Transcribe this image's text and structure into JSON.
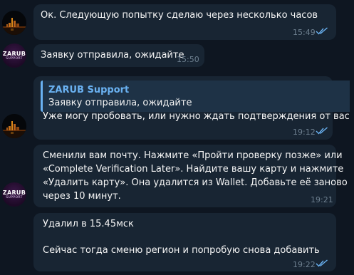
{
  "messages": [
    {
      "id": "m1",
      "text": "Ок. Следующую попытку сделаю через несколько часов",
      "time": "15:49",
      "outgoing": true
    },
    {
      "id": "m2",
      "text": "Заявку отправила, ожидайте",
      "time": "15:50",
      "outgoing": false
    },
    {
      "id": "m3",
      "reply": {
        "name": "ZARUB Support",
        "text": "Заявку отправила, ожидайте"
      },
      "text": "Уже могу пробовать, или нужно ждать подтверждения от вас?",
      "time": "19:12",
      "outgoing": true
    },
    {
      "id": "m4",
      "lines": [
        "Сменили вам почту. Нажмите «Пройти проверку позже» или",
        "«Complete Verification Later». Найдите вашу карту и нажмите",
        "«Удалить карту». Она удалится из Wallet.  Добавьте её заново",
        "через 10 минут."
      ],
      "time": "19:21",
      "outgoing": false
    },
    {
      "id": "m5",
      "lines": [
        "Удалил в 15.45мск",
        "",
        "Сейчас тогда сменю регион и попробую снова добавить"
      ],
      "time": "19:22",
      "outgoing": true
    }
  ],
  "avatars": {
    "zarub": {
      "logo": "ZARUB",
      "sub": "SUPPORT"
    }
  },
  "colors": {
    "background": "#0e1621",
    "bubble": "#182533",
    "accent": "#6ab2f2",
    "time": "#6d7f8f",
    "brand": "#e64a9a"
  },
  "icons": {
    "read_receipt": "double-check-icon",
    "user_avatar": "night-city-avatar",
    "support_avatar": "zarub-logo-avatar"
  }
}
